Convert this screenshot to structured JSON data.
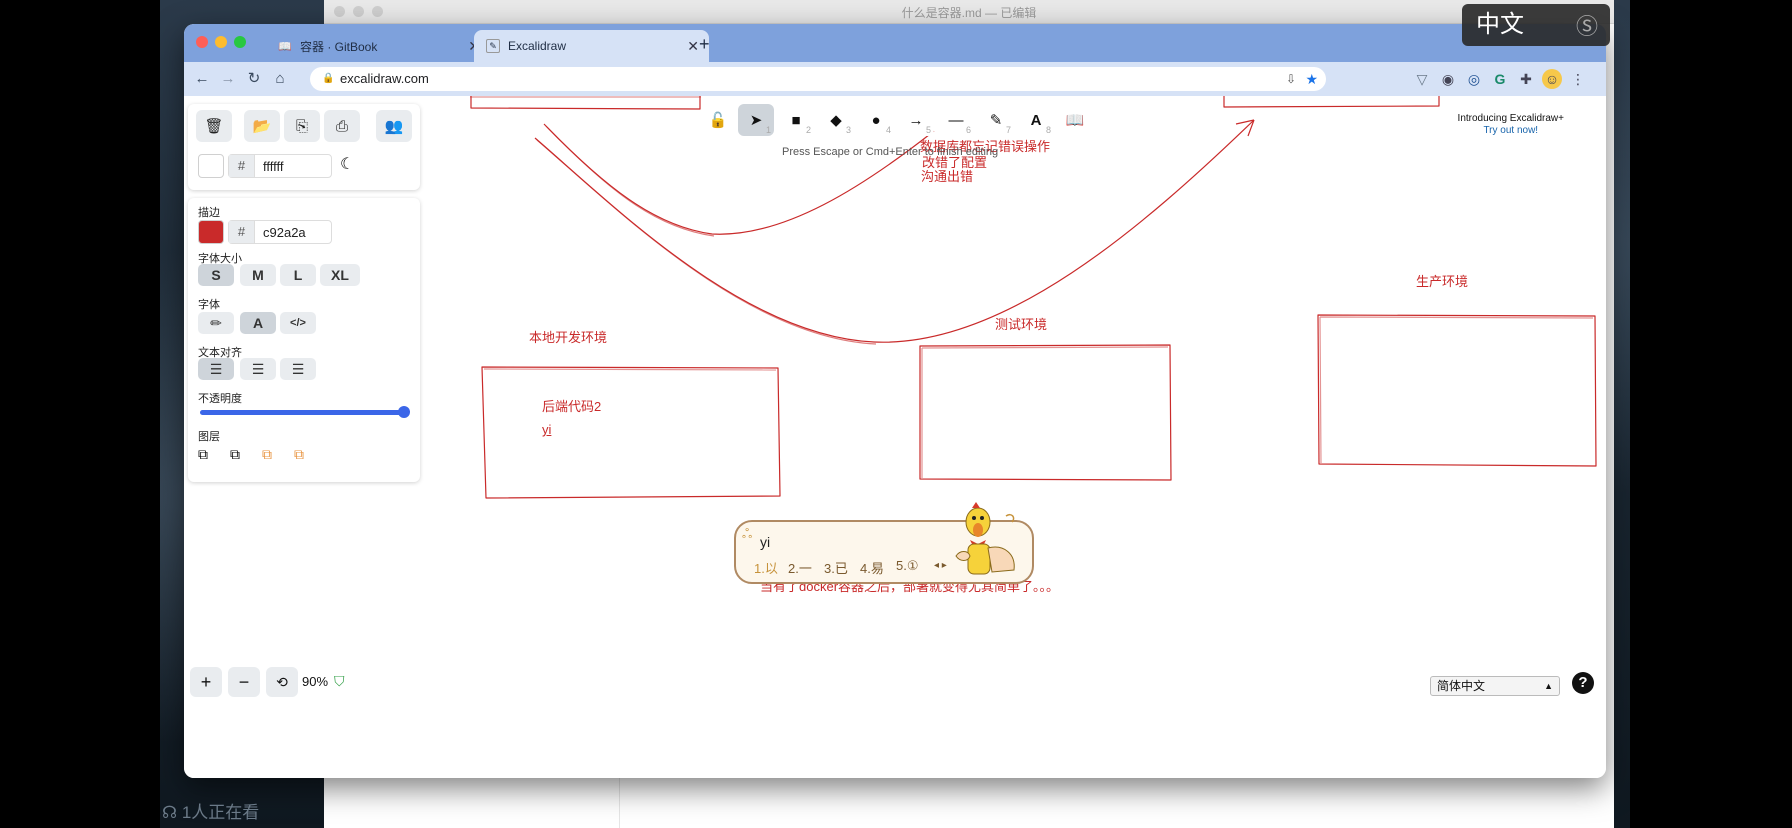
{
  "overlay": {
    "ime_indicator": "中文",
    "viewers_text": "1人正在看"
  },
  "back_window": {
    "title": "什么是容器.md",
    "status": "已编辑"
  },
  "browser": {
    "tabs": [
      {
        "label": "容器 · GitBook",
        "icon": "book-icon"
      },
      {
        "label": "Excalidraw",
        "icon": "excalidraw-icon",
        "active": true
      }
    ],
    "url": "excalidraw.com"
  },
  "excalidraw": {
    "canvas_color": "ffffff",
    "stroke_section": "描边",
    "stroke_color": "c92a2a",
    "font_size_section": "字体大小",
    "font_sizes": [
      "S",
      "M",
      "L",
      "XL"
    ],
    "font_family_section": "字体",
    "text_align_section": "文本对齐",
    "opacity_section": "不透明度",
    "opacity_value": 1.0,
    "layers_section": "图层",
    "editing_hint": "Press Escape or Cmd+Enter to finish editing",
    "promo_title": "Introducing Excalidraw+",
    "promo_link": "Try out now!",
    "tools": [
      {
        "icon": "unlock-icon",
        "key": ""
      },
      {
        "icon": "pointer-icon",
        "key": "1"
      },
      {
        "icon": "rectangle-icon",
        "key": "2"
      },
      {
        "icon": "diamond-icon",
        "key": "3"
      },
      {
        "icon": "ellipse-icon",
        "key": "4"
      },
      {
        "icon": "arrow-icon",
        "key": "5"
      },
      {
        "icon": "line-icon",
        "key": "6"
      },
      {
        "icon": "pencil-icon",
        "key": "7"
      },
      {
        "icon": "text-icon",
        "key": "8"
      },
      {
        "icon": "library-icon",
        "key": ""
      }
    ],
    "zoom": "90%",
    "language": "简体中文",
    "canvas_texts": {
      "partial_line_1": "数据库都忘记错误操作",
      "partial_line_2": "改错了配置",
      "partial_line_3": "沟通出错",
      "local_env": "本地开发环境",
      "test_env": "测试环境",
      "prod_env": "生产环境",
      "backend_code": "后端代码2",
      "typing": "yi",
      "bottom_note": "当有了docker容器之后，部署就变得尤其简单了。。。"
    },
    "ime": {
      "composition": "yi",
      "candidates": [
        "1.以",
        "2.一",
        "3.已",
        "4.易",
        "5.①"
      ]
    }
  }
}
